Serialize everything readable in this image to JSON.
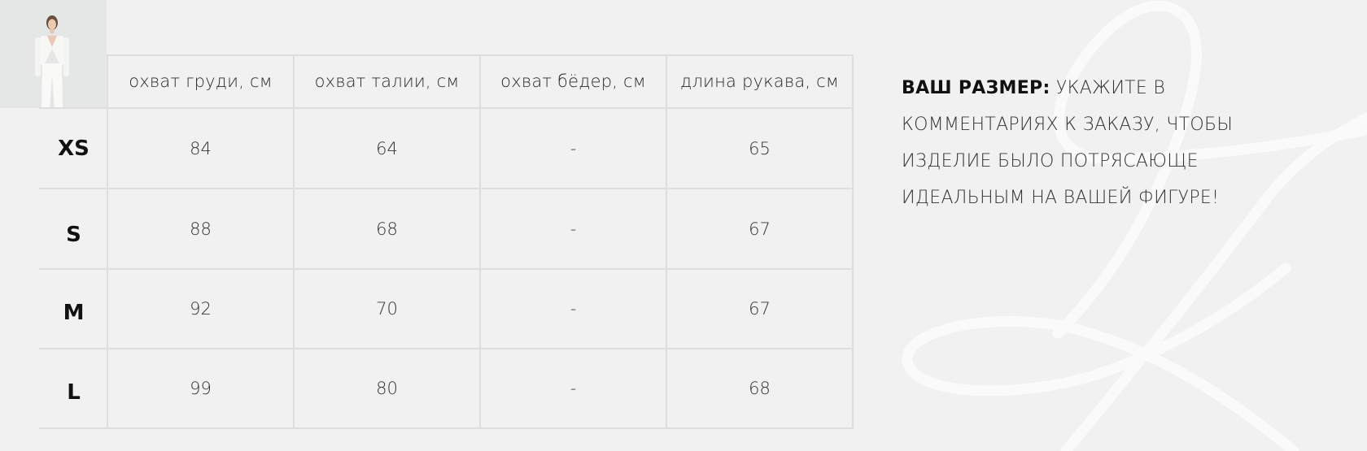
{
  "table": {
    "headers": [
      "охват груди, см",
      "охват талии, см",
      "охват бёдер, см",
      "длина рукава, см"
    ],
    "rows": [
      {
        "size": "XS",
        "values": [
          "84",
          "64",
          "-",
          "65"
        ]
      },
      {
        "size": "S",
        "values": [
          "88",
          "68",
          "-",
          "67"
        ]
      },
      {
        "size": "M",
        "values": [
          "92",
          "70",
          "-",
          "67"
        ]
      },
      {
        "size": "L",
        "values": [
          "99",
          "80",
          "-",
          "68"
        ]
      }
    ]
  },
  "note": {
    "bold": "ВАШ РАЗМЕР:",
    "text": "УКАЖИТЕ В КОММЕНТАРИЯХ К ЗАКАЗУ, ЧТОБЫ ИЗДЕЛИЕ БЫЛО ПОТРЯСАЮЩЕ ИДЕАЛЬНЫМ НА ВАШЕЙ ФИГУРЕ!"
  },
  "colors": {
    "background": "#f1f1f1",
    "grid_line": "#dedede",
    "text": "#333333"
  }
}
